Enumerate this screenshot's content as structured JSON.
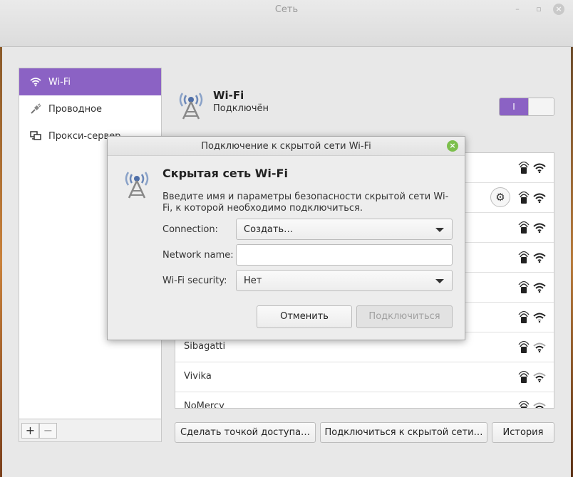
{
  "window": {
    "title": "Сеть"
  },
  "sidebar": {
    "items": [
      {
        "label": "Wi-Fi",
        "icon": "wifi-icon",
        "active": true
      },
      {
        "label": "Проводное",
        "icon": "wired-plug-icon",
        "active": false
      },
      {
        "label": "Прокси-сервер",
        "icon": "proxy-monitor-icon",
        "active": false
      }
    ],
    "add_label": "+",
    "remove_label": "−"
  },
  "main": {
    "title": "Wi-Fi",
    "status": "Подключён",
    "toggle_on_label": "I",
    "networks": [
      {
        "name": ""
      },
      {
        "name": ""
      },
      {
        "name": ""
      },
      {
        "name": ""
      },
      {
        "name": ""
      },
      {
        "name": ""
      },
      {
        "name": "Sibagatti"
      },
      {
        "name": "Vivika"
      },
      {
        "name": "NoMercy"
      }
    ],
    "buttons": {
      "hotspot": "Сделать точкой доступа…",
      "hidden": "Подключиться к скрытой сети…",
      "history": "История"
    }
  },
  "dialog": {
    "title": "Подключение к скрытой сети Wi-Fi",
    "heading": "Скрытая сеть Wi-Fi",
    "description": "Введите имя и параметры безопасности скрытой сети Wi-Fi, к которой необходимо подключиться.",
    "connection_label": "Connection:",
    "connection_value": "Создать…",
    "network_name_label": "Network name:",
    "network_name_value": "",
    "security_label": "Wi-Fi security:",
    "security_value": "Нет",
    "cancel": "Отменить",
    "connect": "Подключиться"
  },
  "colors": {
    "accent": "#8b62c4",
    "close_green": "#7cbf4c"
  }
}
